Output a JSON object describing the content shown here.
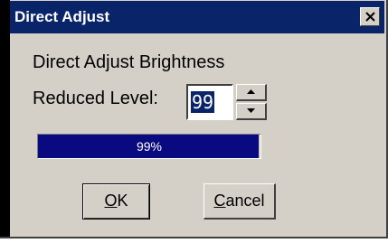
{
  "window": {
    "title": "Direct Adjust",
    "close_icon": "close-icon"
  },
  "content": {
    "heading": "Direct Adjust Brightness",
    "level_label": "Reduced Level:",
    "level_value": "99",
    "spin_up_icon": "arrow-up-icon",
    "spin_down_icon": "arrow-down-icon"
  },
  "progress": {
    "value": 0.99,
    "text": "99%"
  },
  "buttons": {
    "ok_mnemonic": "O",
    "ok_rest": "K",
    "cancel_mnemonic": "C",
    "cancel_rest": "ancel"
  },
  "colors": {
    "titlebar": "#0a246a",
    "progress_fill": "#0a0a80",
    "face": "#d4d0c8"
  }
}
